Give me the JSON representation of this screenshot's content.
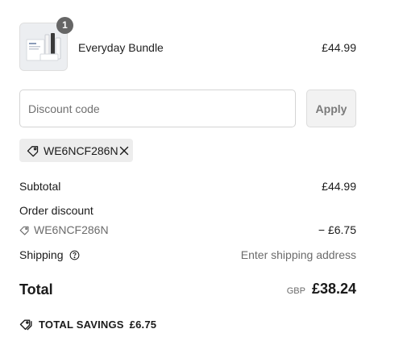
{
  "line_item": {
    "quantity": "1",
    "name": "Everyday Bundle",
    "price": "£44.99"
  },
  "discount": {
    "placeholder": "Discount code",
    "value": "",
    "apply_label": "Apply",
    "applied_code": "WE6NCF286N"
  },
  "summary": {
    "subtotal_label": "Subtotal",
    "subtotal_value": "£44.99",
    "order_discount_label": "Order discount",
    "order_discount_code": "WE6NCF286N",
    "order_discount_value": "− £6.75",
    "shipping_label": "Shipping",
    "shipping_value": "Enter shipping address",
    "total_label": "Total",
    "total_currency": "GBP",
    "total_value": "£38.24",
    "savings_label": "TOTAL SAVINGS",
    "savings_value": "£6.75"
  },
  "icons": {
    "tag": "tag-icon",
    "close": "close-icon",
    "info": "info-icon",
    "savings": "double-tag-icon"
  },
  "colors": {
    "muted_text": "#6b6b6b",
    "badge_bg": "#666666",
    "tag_bg": "#ededed",
    "button_bg": "#f2f2f2"
  }
}
